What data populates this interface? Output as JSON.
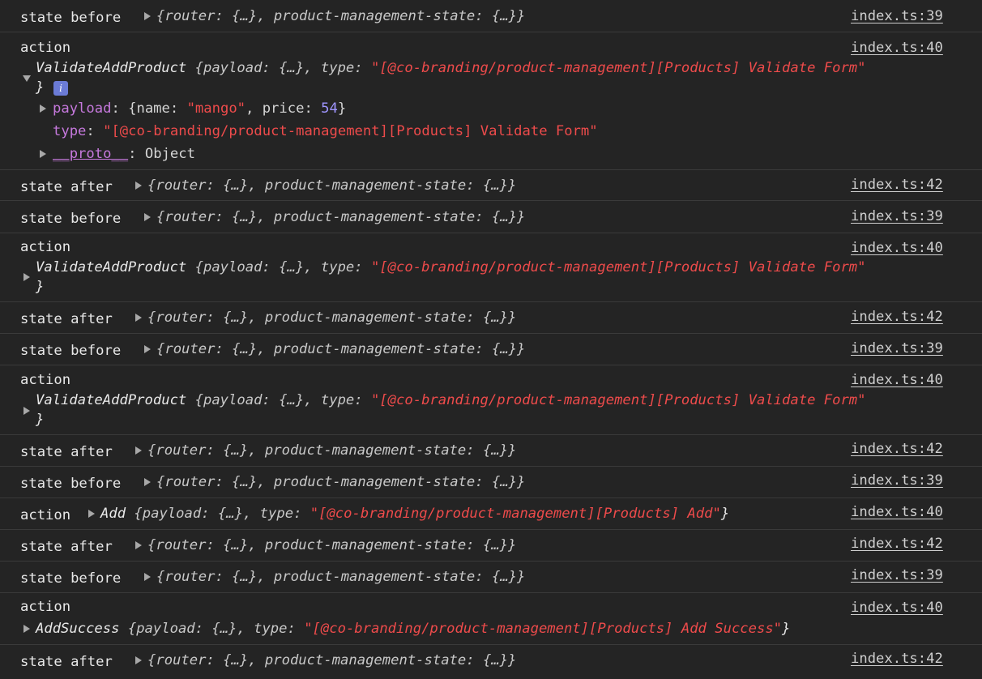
{
  "labels": {
    "state_before": "state before",
    "state_after": "state after",
    "action": "action"
  },
  "state_summary": {
    "open": "{",
    "router_key": "router",
    "router_val": "{…}",
    "pms_key": "product-management-state",
    "pms_val": "{…}",
    "close": "}"
  },
  "sources": {
    "before": "index.ts:39",
    "action": "index.ts:40",
    "after": "index.ts:42"
  },
  "actions": {
    "validate": {
      "name": "ValidateAddProduct",
      "type_string": "\"[@co-branding/product-management][Products] Validate Form\""
    },
    "add": {
      "name": "Add",
      "type_string": "\"[@co-branding/product-management][Products] Add\""
    },
    "add_success": {
      "name": "AddSuccess",
      "type_string": "\"[@co-branding/product-management][Products] Add Success\""
    }
  },
  "common": {
    "payload_key": "payload",
    "type_key": "type",
    "ellipsis_obj": "{…}",
    "colon": ":",
    "comma": ",",
    "open_brace": "{",
    "close_brace": "}"
  },
  "expanded": {
    "payload_key": "payload",
    "payload_open": "{name: ",
    "name_value": "\"mango\"",
    "price_label": ", price: ",
    "price_value": "54",
    "payload_close": "}",
    "type_key": "type",
    "type_value": "\"[@co-branding/product-management][Products] Validate Form\"",
    "proto_key": "__proto__",
    "proto_value": "Object",
    "info_glyph": "i"
  }
}
